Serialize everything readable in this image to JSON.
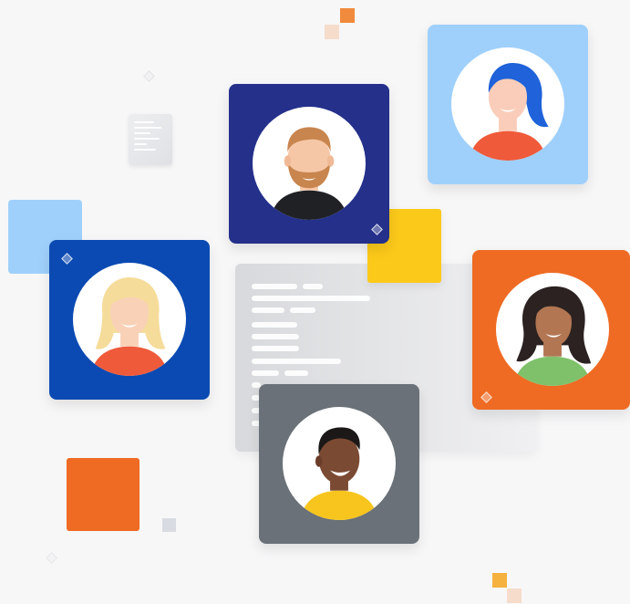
{
  "illustration": {
    "subject": "team-avatars",
    "colors": {
      "background": "#f7f7f8",
      "navy": "#24308a",
      "royal_blue": "#0b4ab2",
      "light_blue": "#9fd0fb",
      "orange": "#ef6b23",
      "slate": "#6a7178",
      "yellow": "#fbc91a"
    },
    "avatars": [
      {
        "id": "bearded-man",
        "card_color": "#24308a",
        "hair": "#c8854e",
        "skin": "#f6c7a7"
      },
      {
        "id": "blue-haired-woman",
        "card_color": "#9fd0fb",
        "hair": "#1f62d9",
        "skin": "#f9cdb9"
      },
      {
        "id": "blonde-woman",
        "card_color": "#0b4ab2",
        "hair": "#f6dc9a",
        "skin": "#f9d1b7"
      },
      {
        "id": "dark-haired-woman",
        "card_color": "#ef6b23",
        "hair": "#2b2221",
        "skin": "#b27652"
      },
      {
        "id": "smiling-man",
        "card_color": "#6a7178",
        "hair": "#1b1817",
        "skin": "#7b4a32"
      }
    ]
  }
}
